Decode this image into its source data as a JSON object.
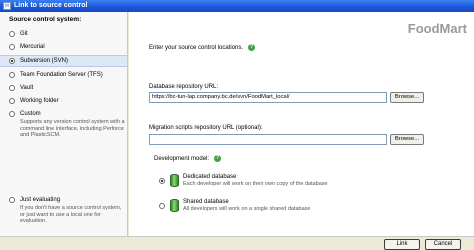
{
  "window": {
    "title": "Link to source control"
  },
  "sidebar": {
    "heading": "Source control system:",
    "options": [
      {
        "label": "Git"
      },
      {
        "label": "Mercurial"
      },
      {
        "label": "Subversion (SVN)"
      },
      {
        "label": "Team Foundation Server (TFS)"
      },
      {
        "label": "Vault"
      },
      {
        "label": "Working folder"
      },
      {
        "label": "Custom",
        "description": "Supports any version control system with a command line interface, including Perforce and PlasticSCM."
      },
      {
        "label": "Just evaluating",
        "description": "If you don't have a source control system, or just want to use a local one for evaluation."
      }
    ]
  },
  "main": {
    "brand": "FoodMart",
    "intro": "Enter your source control locations.",
    "repo_label": "Database repository URL:",
    "repo_value": "https://bc-tun-lap.company.bc.de/svn/FoodMart_local/",
    "migrations_label": "Migration scripts repository URL (optional):",
    "migrations_value": "",
    "browse_label": "Browse...",
    "dev_model_label": "Development model:",
    "dedicated_title": "Dedicated database",
    "dedicated_desc": "Each developer will work on their own copy of the database",
    "shared_title": "Shared database",
    "shared_desc": "All developers will work on a single shared database"
  },
  "footer": {
    "link_label": "Link",
    "cancel_label": "Cancel"
  }
}
